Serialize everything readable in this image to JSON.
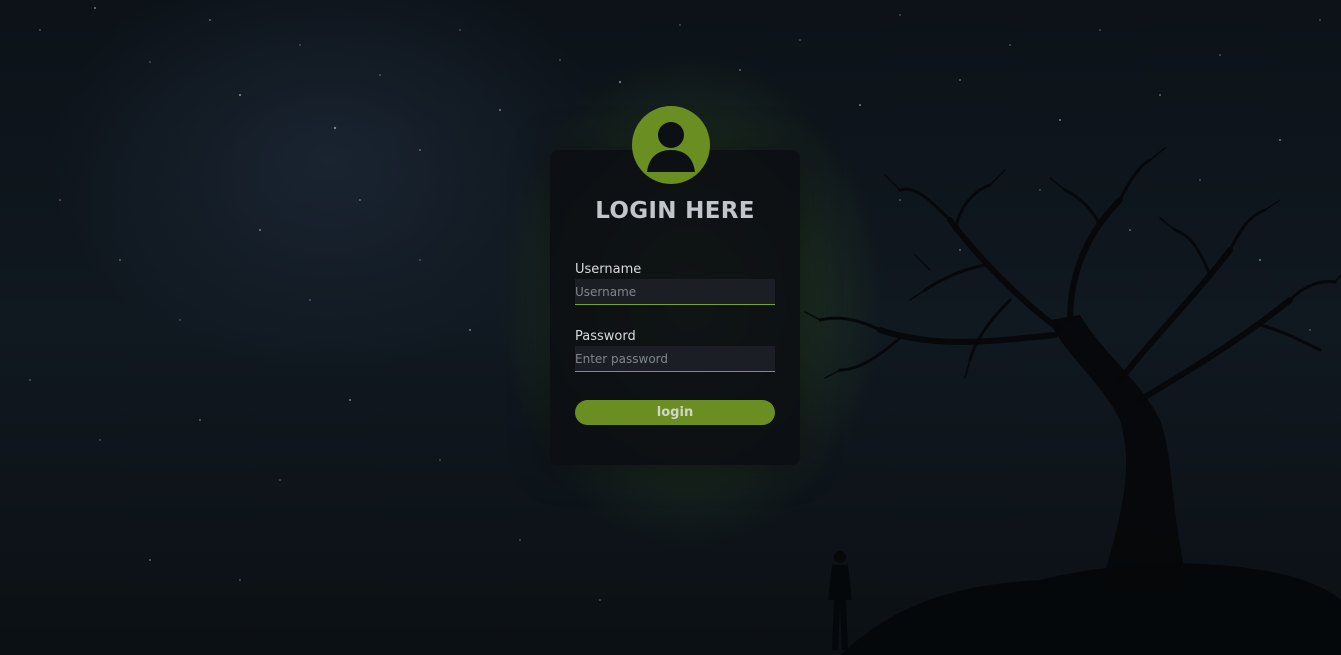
{
  "page": {
    "title": "LOGIN HERE"
  },
  "form": {
    "username_label": "Username",
    "username_placeholder": "Username",
    "username_value": "",
    "password_label": "Password",
    "password_placeholder": "Enter password",
    "password_value": "",
    "submit_label": "login"
  },
  "icons": {
    "avatar": "user-circle-icon"
  },
  "colors": {
    "accent": "#6b8e23",
    "card_background": "#0c0f14",
    "title_text": "#c2c6cb",
    "label_text": "#d8dade",
    "input_background": "#1b1f25",
    "input_underline": "#7aa12a"
  }
}
